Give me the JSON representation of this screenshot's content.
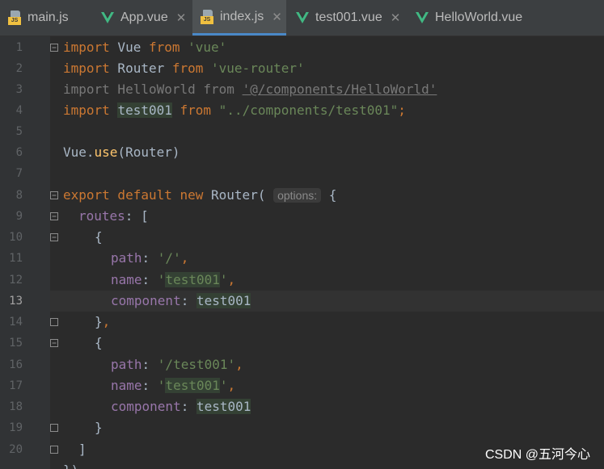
{
  "tabs": [
    {
      "label": "main.js",
      "icon": "js-file-icon",
      "active": false
    },
    {
      "label": "App.vue",
      "icon": "vue-file-icon",
      "active": false
    },
    {
      "label": "index.js",
      "icon": "js-file-icon",
      "active": true
    },
    {
      "label": "test001.vue",
      "icon": "vue-file-icon",
      "active": false
    },
    {
      "label": "HelloWorld.vue",
      "icon": "vue-file-icon",
      "active": false
    }
  ],
  "close_glyph": "✕",
  "js_badge": "JS",
  "current_line": 13,
  "line_numbers": [
    "1",
    "2",
    "3",
    "4",
    "5",
    "6",
    "7",
    "8",
    "9",
    "10",
    "11",
    "12",
    "13",
    "14",
    "15",
    "16",
    "17",
    "18",
    "19",
    "20"
  ],
  "code": {
    "l1": {
      "kw": "import",
      "name": " Vue ",
      "from": "from",
      "str": " 'vue'"
    },
    "l2": {
      "kw": "import",
      "name": " Router ",
      "from": "from",
      "str": " 'vue-router'"
    },
    "l3": {
      "text": "import HelloWorld from ",
      "path": "'@/components/HelloWorld'"
    },
    "l4": {
      "kw": "import",
      "name": "test001",
      "from": "from",
      "str": " \"../components/test001\"",
      "semi": ";"
    },
    "l6": {
      "obj": "Vue.",
      "fn": "use",
      "args": "(Router)"
    },
    "l8": {
      "kw": "export default new",
      "cls": " Router(",
      "hint": "options:",
      "brace": " {"
    },
    "l9": {
      "prop": "routes",
      "rest": ": ["
    },
    "l10": {
      "text": "{"
    },
    "l11": {
      "prop": "path",
      "colon": ": ",
      "str": "'/'",
      "comma": ","
    },
    "l12": {
      "prop": "name",
      "colon": ": ",
      "q1": "'",
      "val": "test001",
      "q2": "'",
      "comma": ","
    },
    "l13": {
      "prop": "component",
      "colon": ": ",
      "val": "test001"
    },
    "l14": {
      "text": "}",
      "comma": ","
    },
    "l15": {
      "text": "{"
    },
    "l16": {
      "prop": "path",
      "colon": ": ",
      "str": "'/test001'",
      "comma": ","
    },
    "l17": {
      "prop": "name",
      "colon": ": ",
      "q1": "'",
      "val": "test001",
      "q2": "'",
      "comma": ","
    },
    "l18": {
      "prop": "component",
      "colon": ": ",
      "val": "test001"
    },
    "l19": {
      "text": "}"
    },
    "l20": {
      "text": "]"
    },
    "l21": {
      "text": "})"
    }
  },
  "watermark": "CSDN @五河今心",
  "colors": {
    "keyword": "#cc7832",
    "string": "#6a8759",
    "property": "#9876aa",
    "function": "#ffc66d",
    "text": "#a9b7c6",
    "background": "#2b2b2b"
  }
}
